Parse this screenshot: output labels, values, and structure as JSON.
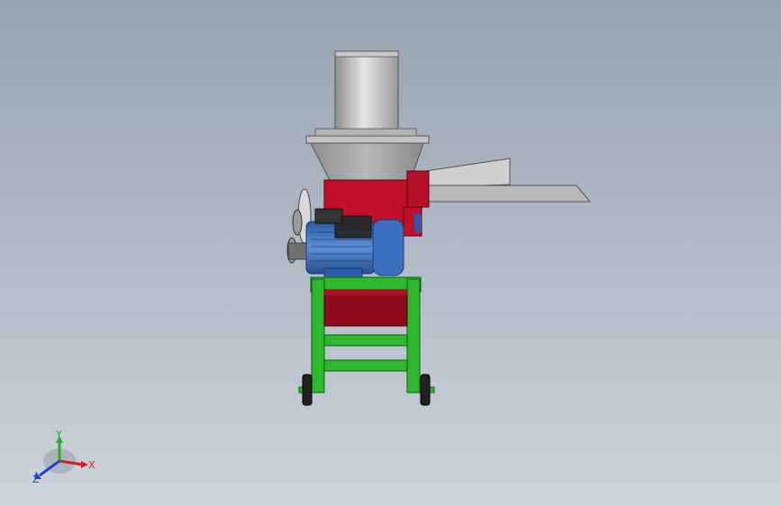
{
  "viewport": {
    "background_top": "#98a4b2",
    "background_bottom": "#cdd3da"
  },
  "model": {
    "colors": {
      "frame": "#2eb82e",
      "housing": "#c0102a",
      "motor": "#3b6fb6",
      "hopper": "#a9a9a9",
      "chute": "#b9b9b9",
      "wheels": "#222222"
    }
  },
  "triad": {
    "x_label": "X",
    "y_label": "Y",
    "z_label": "Z",
    "x_color": "#d02020",
    "y_color": "#20b020",
    "z_color": "#2040d0"
  }
}
